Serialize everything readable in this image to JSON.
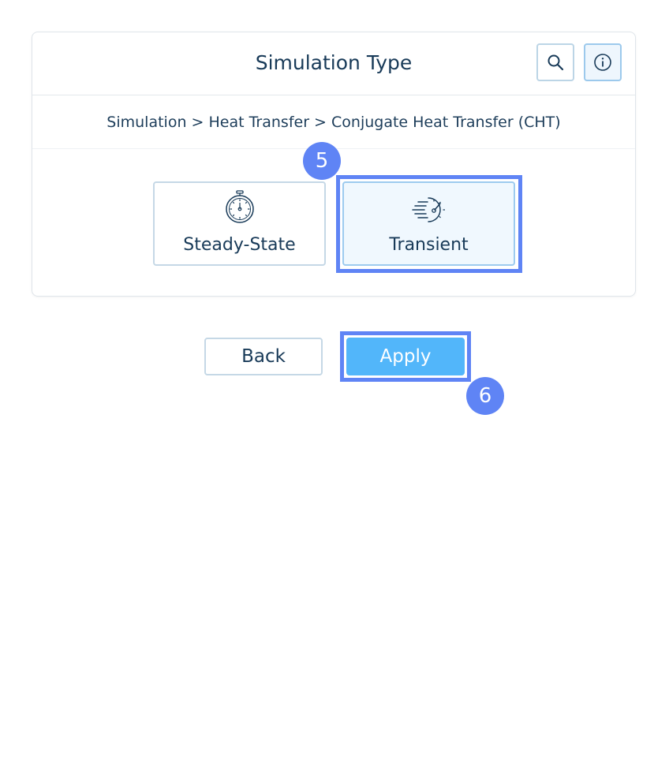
{
  "header": {
    "title": "Simulation Type",
    "search_icon": "search-icon",
    "info_icon": "info-icon"
  },
  "breadcrumb": {
    "text": "Simulation > Heat Transfer > Conjugate Heat Transfer (CHT)",
    "items": [
      "Simulation",
      "Heat Transfer",
      "Conjugate Heat Transfer (CHT)"
    ]
  },
  "options": [
    {
      "label": "Steady-State",
      "icon": "stopwatch-icon",
      "selected": false
    },
    {
      "label": "Transient",
      "icon": "speedometer-icon",
      "selected": true
    }
  ],
  "actions": {
    "back_label": "Back",
    "apply_label": "Apply"
  },
  "steps": {
    "step5": "5",
    "step6": "6"
  },
  "colors": {
    "accent": "#5f84f5",
    "apply_bg": "#52b6fa",
    "text": "#183a58",
    "selected_bg": "#f0f8fe"
  }
}
